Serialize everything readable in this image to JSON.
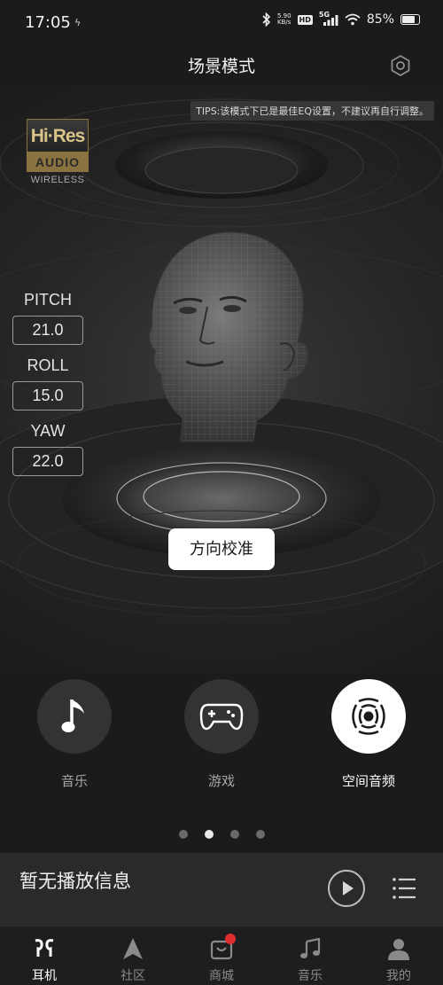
{
  "status_bar": {
    "time": "17:05",
    "net_speed_value": "5.90",
    "net_speed_unit": "KB/s",
    "hd": "HD",
    "network": "5G",
    "battery_percent": "85%",
    "battery_level": 0.85
  },
  "header": {
    "title": "场景模式",
    "settings_icon": "settings-hexagon-icon"
  },
  "scene": {
    "tips": "TIPS:该模式下已是最佳EQ设置，不建议再自行调整。",
    "hires": {
      "top": "Hi·Res",
      "middle": "AUDIO",
      "bottom": "WIRELESS"
    },
    "axes": [
      {
        "label": "PITCH",
        "value": "21.0"
      },
      {
        "label": "ROLL",
        "value": "15.0"
      },
      {
        "label": "YAW",
        "value": "22.0"
      }
    ],
    "calibrate_button": "方向校准"
  },
  "modes": [
    {
      "label": "音乐",
      "icon": "music-note-icon",
      "active": false
    },
    {
      "label": "游戏",
      "icon": "gamepad-icon",
      "active": false
    },
    {
      "label": "空间音频",
      "icon": "spatial-audio-icon",
      "active": true
    }
  ],
  "pager": {
    "count": 4,
    "active_index": 1
  },
  "player": {
    "text": "暂无播放信息",
    "play_icon": "play-icon",
    "playlist_icon": "playlist-icon"
  },
  "bottom_nav": [
    {
      "label": "耳机",
      "icon": "earbuds-icon",
      "active": true
    },
    {
      "label": "社区",
      "icon": "community-icon",
      "active": false
    },
    {
      "label": "商城",
      "icon": "store-icon",
      "active": false,
      "badge": true
    },
    {
      "label": "音乐",
      "icon": "music-icon",
      "active": false
    },
    {
      "label": "我的",
      "icon": "profile-icon",
      "active": false
    }
  ],
  "colors": {
    "background": "#1b1b1b",
    "accent": "#ffffff",
    "badge": "#e02d2d",
    "hires_gold": "#8a7340"
  }
}
